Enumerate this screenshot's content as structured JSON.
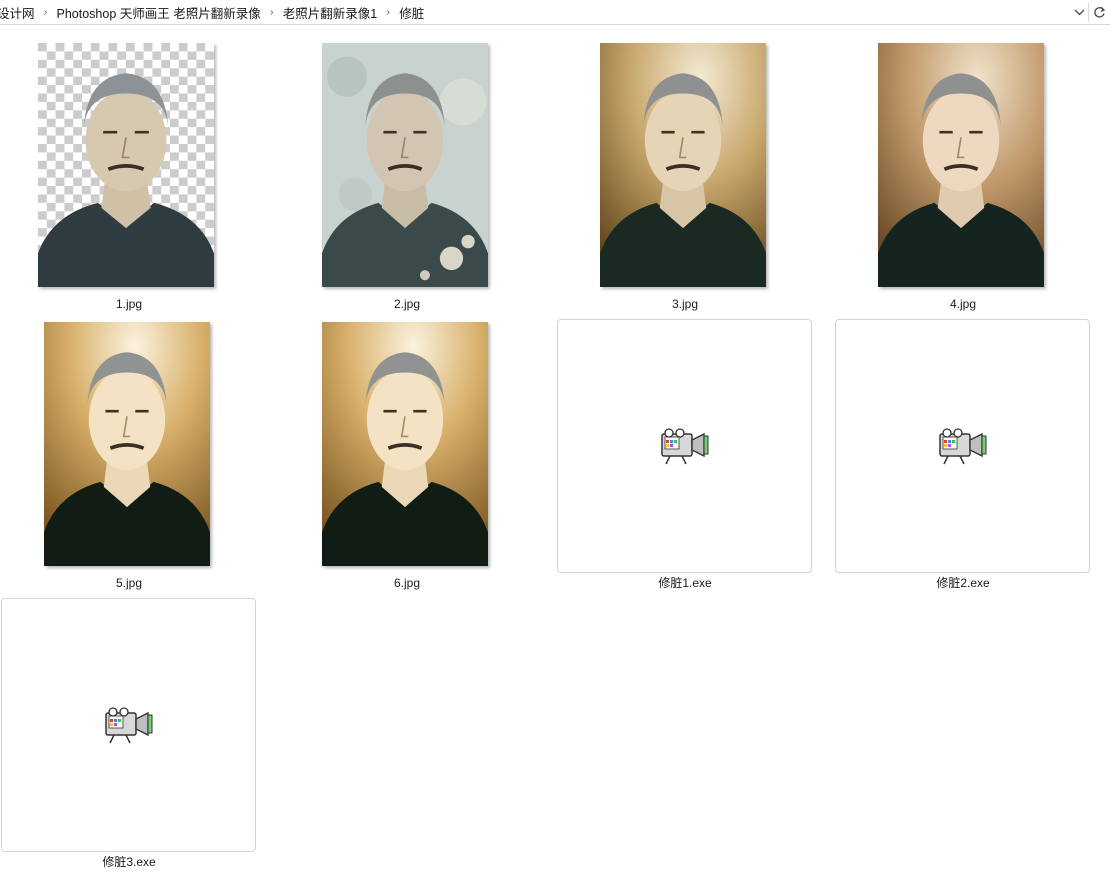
{
  "breadcrumb": {
    "items": [
      "设计网",
      "Photoshop 天师画王 老照片翻新录像",
      "老照片翻新录像1",
      "修脏"
    ],
    "separator": "›"
  },
  "files": [
    {
      "name": "1.jpg",
      "type": "image",
      "variant": "transparent-cutout"
    },
    {
      "name": "2.jpg",
      "type": "image",
      "variant": "damaged-original"
    },
    {
      "name": "3.jpg",
      "type": "image",
      "variant": "gold-background"
    },
    {
      "name": "4.jpg",
      "type": "image",
      "variant": "sepia-background"
    },
    {
      "name": "5.jpg",
      "type": "image",
      "variant": "bright-gold"
    },
    {
      "name": "6.jpg",
      "type": "image",
      "variant": "bright-gold"
    },
    {
      "name": "修脏1.exe",
      "type": "exe",
      "icon": "video-camera-icon"
    },
    {
      "name": "修脏2.exe",
      "type": "exe",
      "icon": "video-camera-icon"
    },
    {
      "name": "修脏3.exe",
      "type": "exe",
      "icon": "video-camera-icon"
    }
  ],
  "icons": {
    "dropdown": "chevron-down-icon",
    "refresh": "refresh-icon",
    "separator": "chevron-right-icon"
  },
  "colors": {
    "border": "#d3d3d3",
    "background": "#ffffff",
    "coat": "#1b2620",
    "skin": "#e4d3b8",
    "hair": "#8d9194"
  }
}
